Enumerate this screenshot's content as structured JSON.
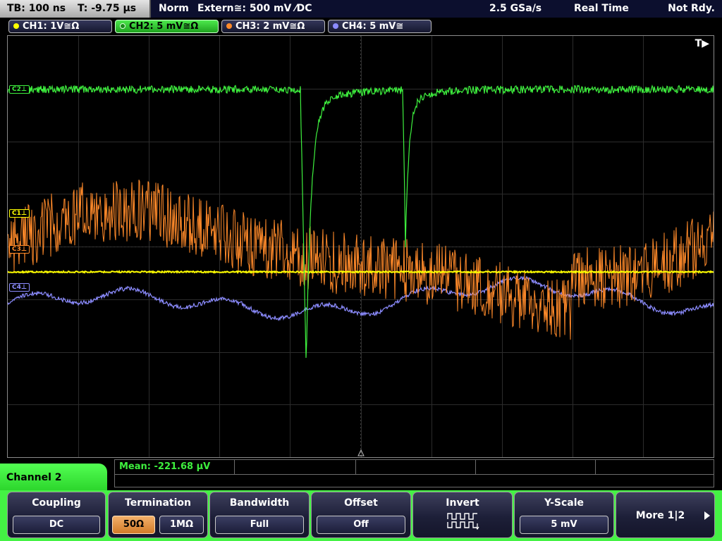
{
  "status": {
    "timebase": "TB: 100 ns",
    "trigger_time": "T: -9.75 µs",
    "trigger_mode": "Norm",
    "trigger_source": "Extern≅: 500 mV ⁄DC",
    "sample_rate": "2.5 GSa/s",
    "acq_mode": "Real Time",
    "state": "Not Rdy."
  },
  "channels": [
    {
      "label": "CH1: 1V≅Ω",
      "color": "#ffff00",
      "active": false
    },
    {
      "label": "CH2: 5 mV≅Ω",
      "color": "#3ef03e",
      "active": true
    },
    {
      "label": "CH3: 2 mV≅Ω",
      "color": "#ff8a2a",
      "active": false
    },
    {
      "label": "CH4: 5 mV≅",
      "color": "#8c8cff",
      "active": false
    }
  ],
  "markers": {
    "ch1": "C1⊥",
    "ch2": "C2⊥",
    "ch3": "C3⊥",
    "ch4": "C4⊥"
  },
  "screen": {
    "trigger_indicator": "T▶"
  },
  "measurement": {
    "mean": "Mean: -221.68 µV"
  },
  "menu": {
    "channel_label": "Channel 2",
    "coupling": {
      "title": "Coupling",
      "value": "DC"
    },
    "termination": {
      "title": "Termination",
      "opt1": "50Ω",
      "opt2": "1MΩ"
    },
    "bandwidth": {
      "title": "Bandwidth",
      "value": "Full"
    },
    "offset": {
      "title": "Offset",
      "value": "Off"
    },
    "invert": {
      "title": "Invert",
      "icon": "invert-waveform-icon"
    },
    "yscale": {
      "title": "Y-Scale",
      "value": "5 mV"
    },
    "more": {
      "label": "More 1|2"
    }
  },
  "colors": {
    "ch1": "#ffff00",
    "ch2": "#3ef03e",
    "ch3": "#ff8a2a",
    "ch4": "#8c8cff",
    "softkey_bar": "#44f244",
    "selected_option": "#e89545"
  }
}
